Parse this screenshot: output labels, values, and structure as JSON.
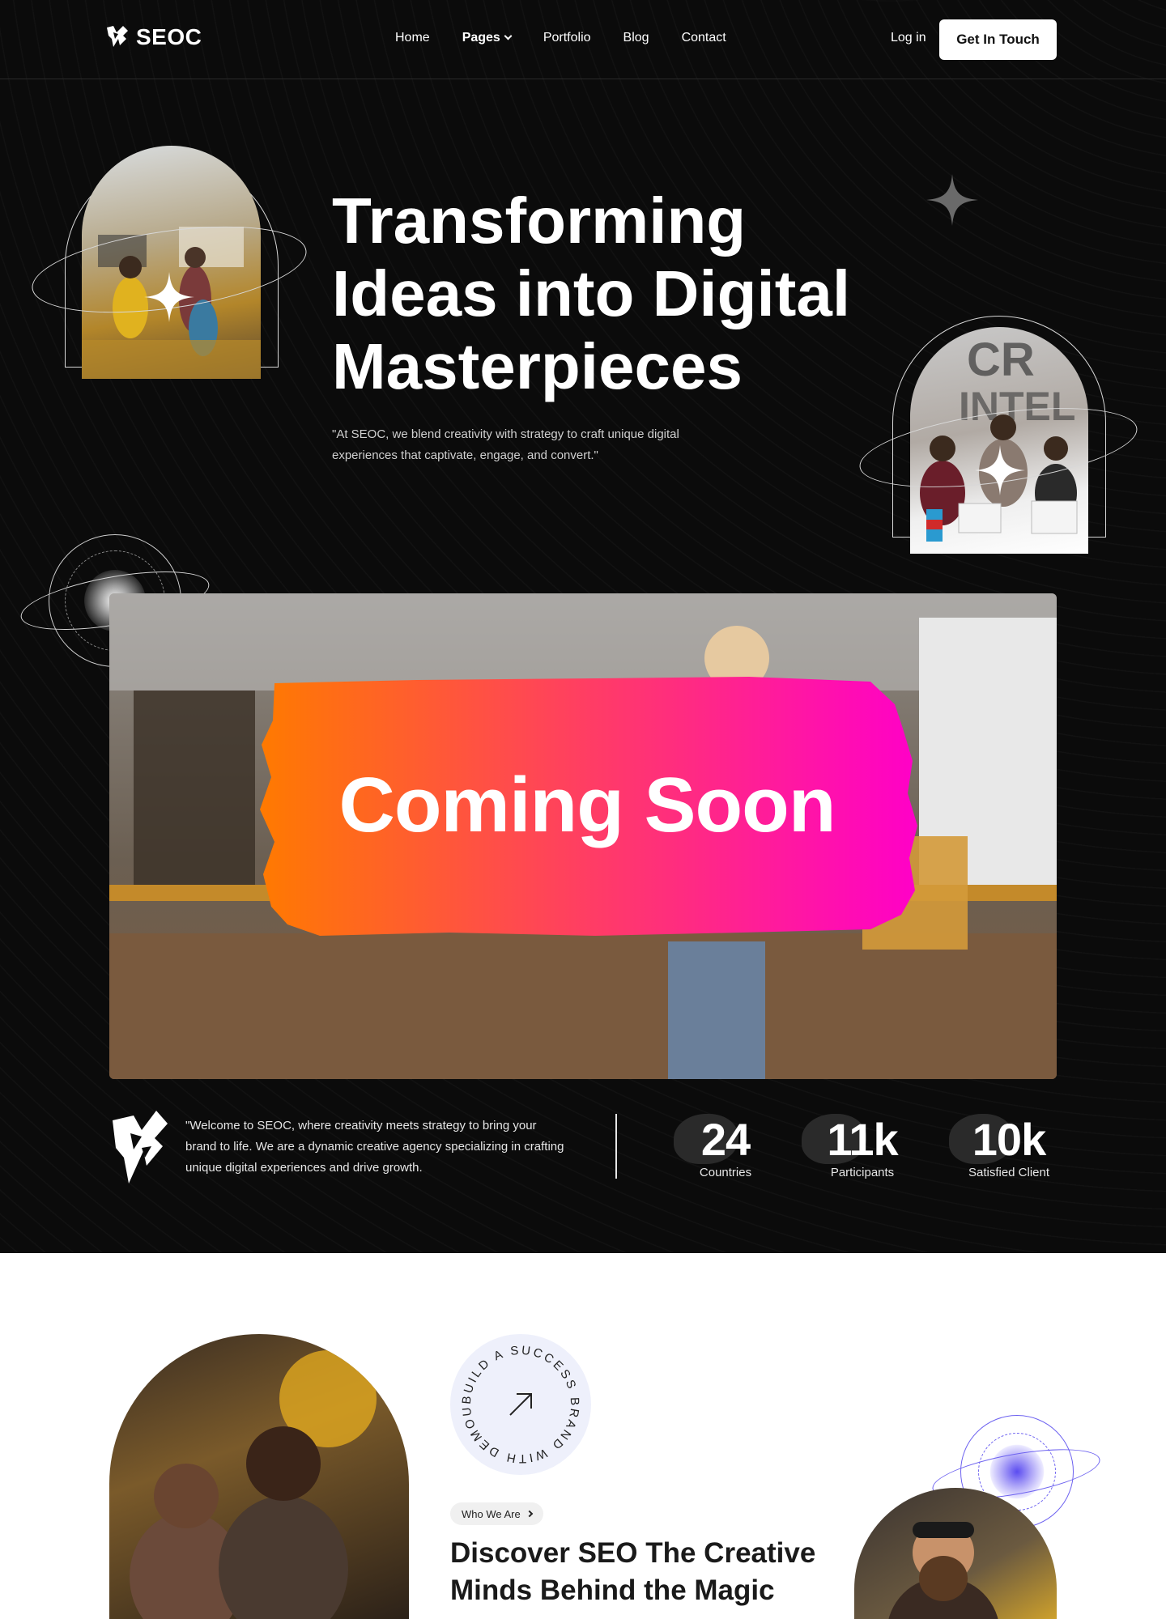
{
  "brand": {
    "name": "SEOC"
  },
  "nav": {
    "items": [
      {
        "label": "Home",
        "active": false
      },
      {
        "label": "Pages",
        "active": true,
        "has_dropdown": true
      },
      {
        "label": "Portfolio",
        "active": false
      },
      {
        "label": "Blog",
        "active": false
      },
      {
        "label": "Contact",
        "active": false
      }
    ],
    "login_label": "Log in",
    "cta_label": "Get In Touch"
  },
  "hero": {
    "title_lines": [
      "Transforming",
      "Ideas into Digital",
      "Masterpieces"
    ],
    "subtitle": "\"At SEOC, we blend creativity with strategy to craft unique digital experiences that captivate, engage, and convert.\""
  },
  "banner": {
    "overlay_text": "Coming Soon",
    "gradient": [
      "#ff7a00",
      "#ff00c8"
    ]
  },
  "welcome": {
    "text": "\"Welcome to SEOC, where creativity meets strategy to bring your brand to life. We are a dynamic creative agency specializing in crafting unique digital experiences and drive growth."
  },
  "stats": [
    {
      "value": "24",
      "label": "Countries"
    },
    {
      "value": "11k",
      "label": "Participants"
    },
    {
      "value": "10k",
      "label": "Satisfied Client"
    }
  ],
  "about": {
    "badge_ring_text": "BUILD A SUCCESS BRAND WITH DEMOUI",
    "pill_label": "Who We Are",
    "title": "Discover SEO The Creative Minds Behind the Magic"
  },
  "colors": {
    "dark_bg": "#0b0b0b",
    "accent_orange": "#ff7a00",
    "accent_pink": "#ff00c8",
    "badge_bg": "#eef0fb",
    "orbit_purple": "#5b4cf0"
  }
}
